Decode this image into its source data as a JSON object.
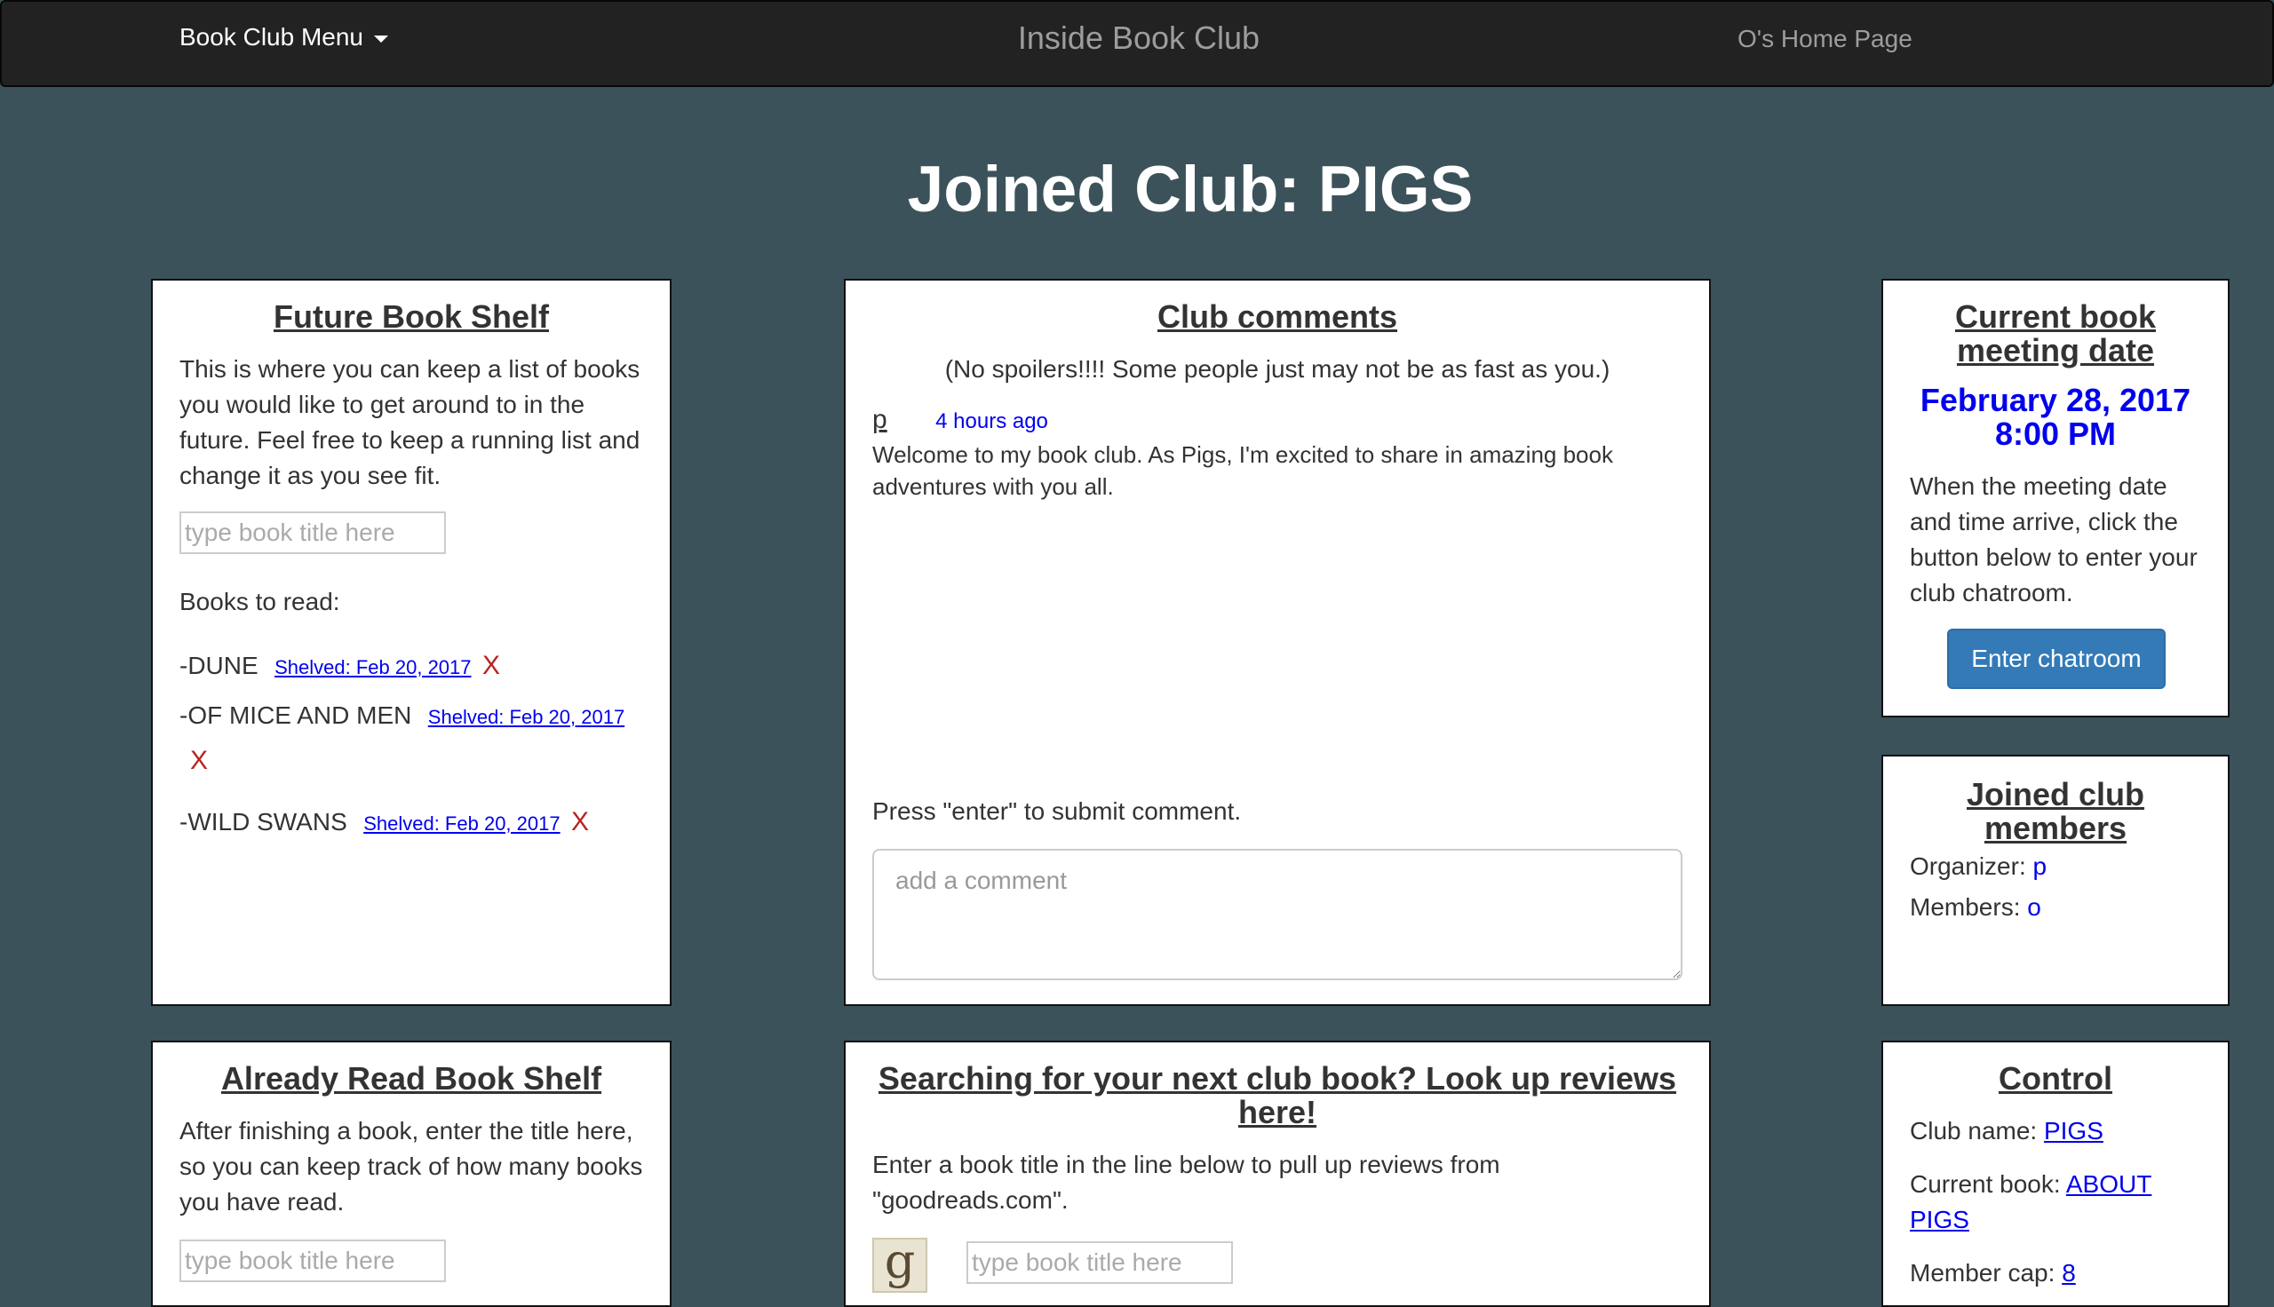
{
  "nav": {
    "menu_label": "Book Club Menu",
    "title": "Inside Book Club",
    "home_label": "O's Home Page"
  },
  "page": {
    "title": "Joined Club: PIGS"
  },
  "future_shelf": {
    "heading": "Future Book Shelf",
    "description": "This is where you can keep a list of books you would like to get around to in the future. Feel free to keep a running list and change it as you see fit.",
    "input_placeholder": "type book title here",
    "list_label": "Books to read:",
    "books": [
      {
        "title": "-DUNE",
        "shelved": "Shelved: Feb 20, 2017",
        "remove": "X"
      },
      {
        "title": "-OF MICE AND MEN",
        "shelved": "Shelved: Feb 20, 2017",
        "remove": "X"
      },
      {
        "title": "-WILD SWANS",
        "shelved": "Shelved: Feb 20, 2017",
        "remove": "X"
      }
    ]
  },
  "comments": {
    "heading": "Club comments",
    "subtitle": "(No spoilers!!!! Some people just may not be as fast as you.)",
    "items": [
      {
        "author": "p",
        "time": "4 hours ago",
        "text": "Welcome to my book club. As Pigs, I'm excited to share in amazing book adventures with you all."
      }
    ],
    "instruction": "Press \"enter\" to submit comment.",
    "placeholder": "add a comment"
  },
  "meeting": {
    "heading": "Current book meeting date",
    "date": "February 28, 2017",
    "time": "8:00 PM",
    "description": "When the meeting date and time arrive, click the button below to enter your club chatroom.",
    "button_label": "Enter chatroom"
  },
  "members": {
    "heading": "Joined club members",
    "organizer_label": "Organizer:",
    "organizer": "p",
    "members_label": "Members:",
    "members_value": "o"
  },
  "read_shelf": {
    "heading": "Already Read Book Shelf",
    "description": "After finishing a book, enter the title here, so you can keep track of how many books you have read.",
    "input_placeholder": "type book title here"
  },
  "reviews": {
    "heading": "Searching for your next club book? Look up reviews here!",
    "description": "Enter a book title in the line below to pull up reviews from \"goodreads.com\".",
    "logo_letter": "g",
    "input_placeholder": "type book title here"
  },
  "control": {
    "heading": "Control",
    "club_name_label": "Club name:",
    "club_name": "PIGS",
    "current_book_label": "Current book:",
    "current_book": "ABOUT PIGS",
    "member_cap_label": "Member cap:",
    "member_cap": "8"
  },
  "colors": {
    "background": "#3c525a",
    "navbar": "#222222",
    "primary_button": "#337ab7",
    "link": "#0000ee",
    "remove": "#bb2222"
  }
}
